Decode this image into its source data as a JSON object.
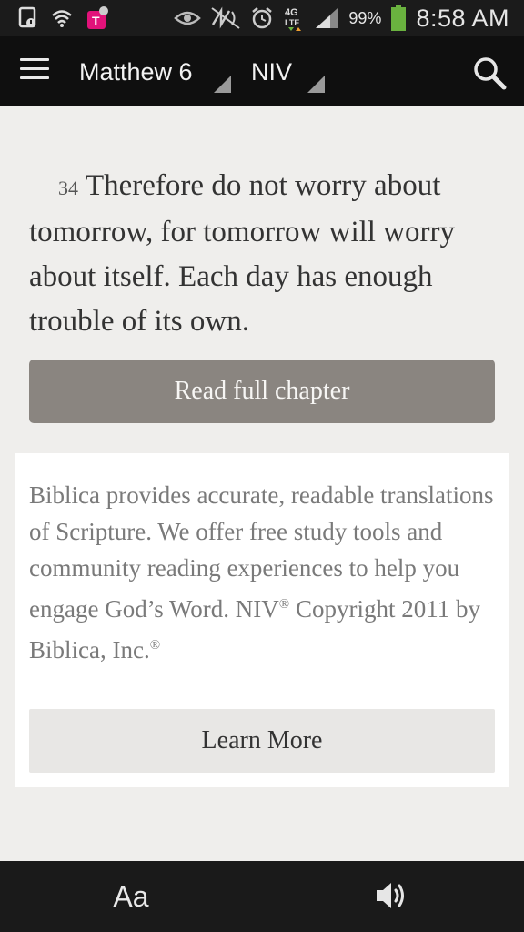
{
  "status_bar": {
    "battery": "99%",
    "time": "8:58 AM",
    "network": "4G LTE",
    "icons": [
      "screenshot-icon",
      "wifi-icon",
      "tmobile-icon",
      "eye-icon",
      "nfc-icon",
      "alarm-icon",
      "lte-icon",
      "signal-icon",
      "battery-icon"
    ]
  },
  "app_bar": {
    "book": "Matthew 6",
    "version": "NIV",
    "icons": [
      "menu-icon",
      "search-icon"
    ]
  },
  "verse": {
    "number": "34",
    "text": "Therefore do not worry about tomorrow, for tomorrow will worry about itself. Each day has enough trouble of its own."
  },
  "read_button": "Read full chapter",
  "info_card": {
    "text_main": "Biblica provides accurate, readable translations of Scripture. We offer free study tools and community reading experiences to help you engage God’s Word. NIV",
    "reg1": "®",
    "text_mid": " Copyright 2011 by Biblica, Inc.",
    "reg2": "®",
    "button": "Learn More"
  },
  "bottom_bar": {
    "font_label": "Aa",
    "icons": [
      "volume-icon"
    ]
  },
  "colors": {
    "read_button_bg": "#8a8580",
    "page_bg": "#efeeec",
    "appbar_bg": "#0f0f0f",
    "battery": "#6ab23f"
  }
}
